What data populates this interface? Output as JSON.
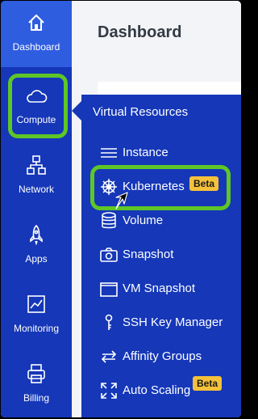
{
  "header": {
    "title": "Dashboard"
  },
  "sidebar": {
    "items": [
      {
        "label": "Dashboard",
        "icon": "home-icon"
      },
      {
        "label": "Compute",
        "icon": "cloud-icon"
      },
      {
        "label": "Network",
        "icon": "network-icon"
      },
      {
        "label": "Apps",
        "icon": "rocket-icon"
      },
      {
        "label": "Monitoring",
        "icon": "chart-icon"
      },
      {
        "label": "Billing",
        "icon": "printer-icon"
      }
    ]
  },
  "flyout": {
    "title": "Virtual Resources",
    "items": [
      {
        "label": "Instance",
        "icon": "server-icon"
      },
      {
        "label": "Kubernetes",
        "icon": "helm-icon",
        "badge": "Beta"
      },
      {
        "label": "Volume",
        "icon": "database-icon"
      },
      {
        "label": "Snapshot",
        "icon": "camera-icon"
      },
      {
        "label": "VM Snapshot",
        "icon": "window-icon"
      },
      {
        "label": "SSH Key Manager",
        "icon": "key-icon"
      },
      {
        "label": "Affinity Groups",
        "icon": "arrows-icon"
      },
      {
        "label": "Auto Scaling",
        "icon": "expand-icon",
        "badge": "Beta"
      }
    ]
  },
  "colors": {
    "sidebar": "#1537b8",
    "active": "#2f5de0",
    "highlight": "#5ec627",
    "badge": "#f5c13a"
  }
}
